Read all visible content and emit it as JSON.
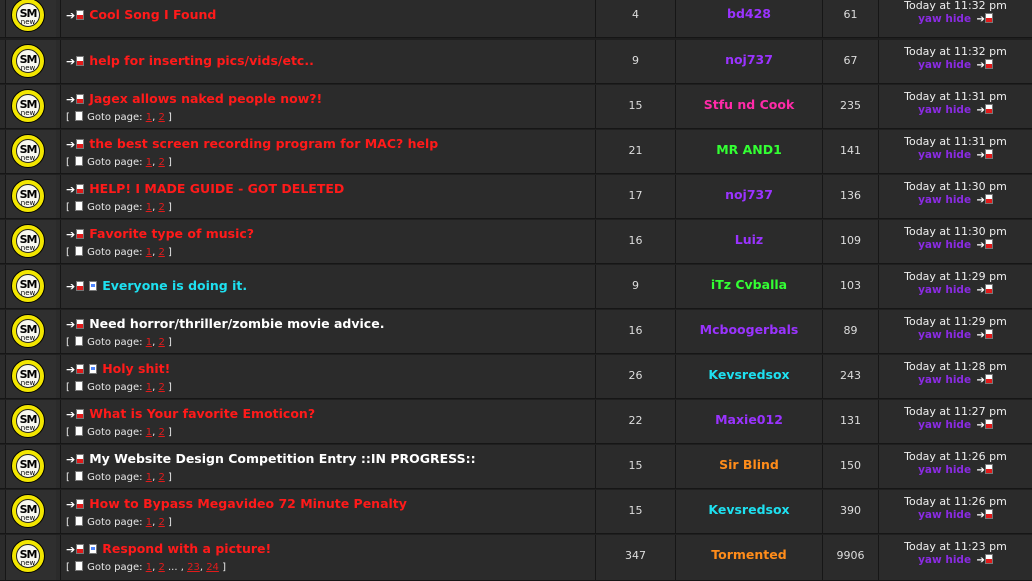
{
  "icon": {
    "top": "SM",
    "bottom": "new",
    "name": "new-posts-icon"
  },
  "goto_label": "Goto page:",
  "topics": [
    {
      "title": "Cool Song I Found",
      "title_color": "#ff1a1a",
      "unread": true,
      "pages": [],
      "replies": "4",
      "author": "bd428",
      "author_color": "#9a33ff",
      "views": "61",
      "last_time": "Today at 11:32 pm",
      "last_user": "yaw hide"
    },
    {
      "title": "help for inserting pics/vids/etc..",
      "title_color": "#ff1a1a",
      "unread": true,
      "pages": [],
      "replies": "9",
      "author": "noj737",
      "author_color": "#9a33ff",
      "views": "67",
      "last_time": "Today at 11:32 pm",
      "last_user": "yaw hide"
    },
    {
      "title": "Jagex allows naked people now?!",
      "title_color": "#ff1a1a",
      "unread": true,
      "pages": [
        "1",
        "2"
      ],
      "replies": "15",
      "author": "Stfu nd Cook",
      "author_color": "#ff2aa8",
      "views": "235",
      "last_time": "Today at 11:31 pm",
      "last_user": "yaw hide"
    },
    {
      "title": "the best screen recording program for MAC? help",
      "title_color": "#ff1a1a",
      "unread": true,
      "pages": [
        "1",
        "2"
      ],
      "replies": "21",
      "author": "MR AND1",
      "author_color": "#33ff33",
      "views": "141",
      "last_time": "Today at 11:31 pm",
      "last_user": "yaw hide"
    },
    {
      "title": "HELP! I MADE GUIDE - GOT DELETED",
      "title_color": "#ff1a1a",
      "unread": true,
      "pages": [
        "1",
        "2"
      ],
      "replies": "17",
      "author": "noj737",
      "author_color": "#9a33ff",
      "views": "136",
      "last_time": "Today at 11:30 pm",
      "last_user": "yaw hide"
    },
    {
      "title": "Favorite type of music?",
      "title_color": "#ff1a1a",
      "unread": true,
      "pages": [
        "1",
        "2"
      ],
      "replies": "16",
      "author": "Luiz",
      "author_color": "#9a33ff",
      "views": "109",
      "last_time": "Today at 11:30 pm",
      "last_user": "yaw hide"
    },
    {
      "title": "Everyone is doing it.",
      "title_color": "#1ee0f0",
      "unread": true,
      "mini": true,
      "pages": [],
      "replies": "9",
      "author": "iTz Cvballa",
      "author_color": "#33ff33",
      "views": "103",
      "last_time": "Today at 11:29 pm",
      "last_user": "yaw hide"
    },
    {
      "title": "Need horror/thriller/zombie movie advice.",
      "title_color": "#ffffff",
      "unread": true,
      "pages": [
        "1",
        "2"
      ],
      "replies": "16",
      "author": "Mcboogerbals",
      "author_color": "#9a33ff",
      "views": "89",
      "last_time": "Today at 11:29 pm",
      "last_user": "yaw hide"
    },
    {
      "title": "Holy shit!",
      "title_color": "#ff1a1a",
      "unread": true,
      "mini": true,
      "pages": [
        "1",
        "2"
      ],
      "replies": "26",
      "author": "Kevsredsox",
      "author_color": "#1ee0f0",
      "views": "243",
      "last_time": "Today at 11:28 pm",
      "last_user": "yaw hide"
    },
    {
      "title": "What is Your favorite Emoticon?",
      "title_color": "#ff1a1a",
      "unread": true,
      "pages": [
        "1",
        "2"
      ],
      "replies": "22",
      "author": "Maxie012",
      "author_color": "#9a33ff",
      "views": "131",
      "last_time": "Today at 11:27 pm",
      "last_user": "yaw hide"
    },
    {
      "title": "My Website Design Competition Entry ::IN PROGRESS::",
      "title_color": "#ffffff",
      "unread": true,
      "pages": [
        "1",
        "2"
      ],
      "replies": "15",
      "author": "Sir Blind",
      "author_color": "#ff8c1a",
      "views": "150",
      "last_time": "Today at 11:26 pm",
      "last_user": "yaw hide"
    },
    {
      "title": "How to Bypass Megavideo 72 Minute Penalty",
      "title_color": "#ff1a1a",
      "unread": true,
      "pages": [
        "1",
        "2"
      ],
      "replies": "15",
      "author": "Kevsredsox",
      "author_color": "#1ee0f0",
      "views": "390",
      "last_time": "Today at 11:26 pm",
      "last_user": "yaw hide"
    },
    {
      "title": "Respond with a picture!",
      "title_color": "#ff1a1a",
      "unread": true,
      "mini": true,
      "pages": [
        "1",
        "2",
        "...",
        "23",
        "24"
      ],
      "replies": "347",
      "author": "Tormented",
      "author_color": "#ff8c1a",
      "views": "9906",
      "last_time": "Today at 11:23 pm",
      "last_user": "yaw hide"
    }
  ]
}
